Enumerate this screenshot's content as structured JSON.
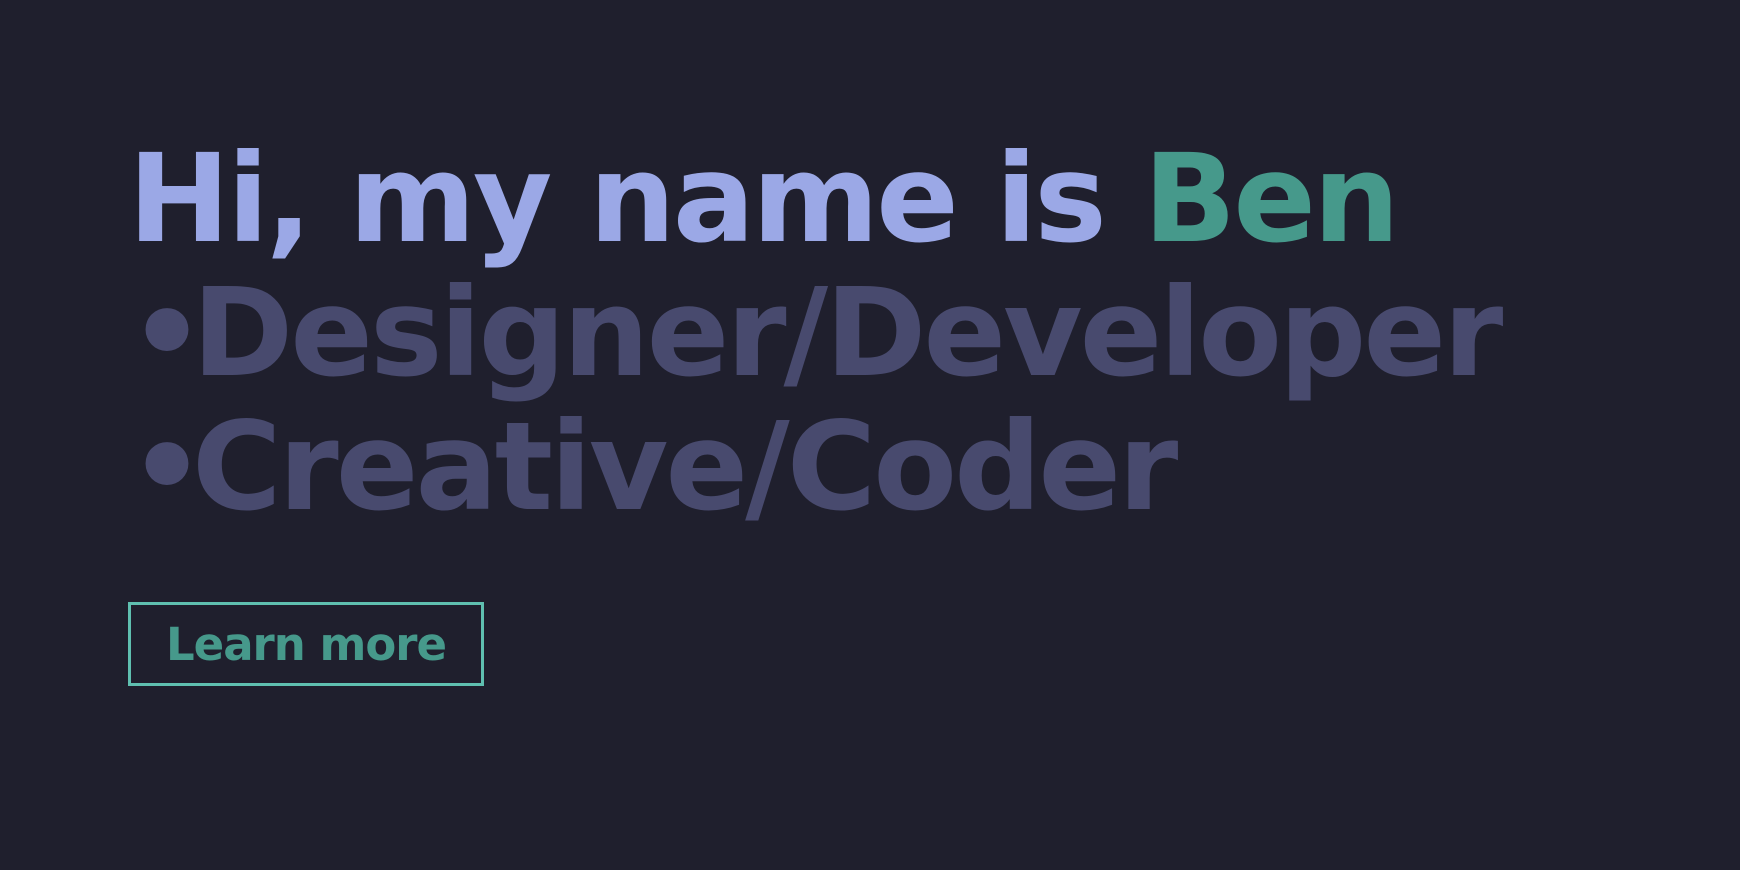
{
  "hero": {
    "greeting": "Hi, my name is ",
    "name": "Ben",
    "roles": [
      {
        "bullet": "•",
        "label": "Designer/Developer"
      },
      {
        "bullet": "•",
        "label": "Creative/Coder"
      }
    ]
  },
  "cta": {
    "label": "Learn more"
  },
  "colors": {
    "background": "#1f1f2d",
    "intro_text": "#9ba8e6",
    "name_accent": "#46998b",
    "role_text": "#484a6e",
    "button_border": "#5fbfb0"
  }
}
